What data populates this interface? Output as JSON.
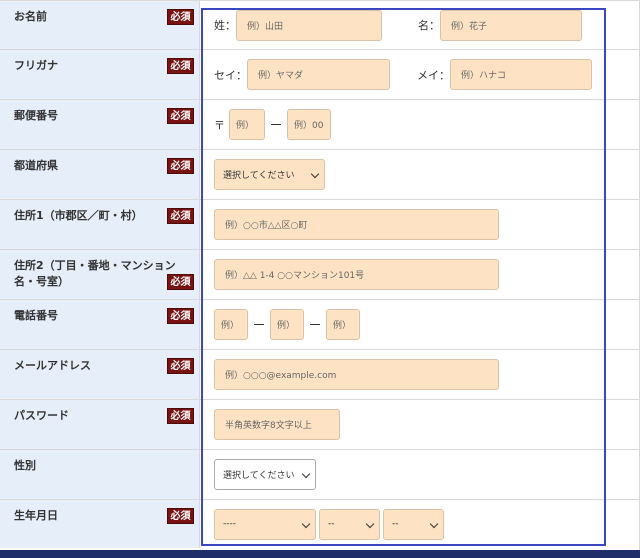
{
  "required_label": "必須",
  "fields": {
    "name": {
      "label": "お名前",
      "sei_label": "姓：",
      "sei_placeholder": "例）山田",
      "mei_label": "名：",
      "mei_placeholder": "例）花子"
    },
    "furigana": {
      "label": "フリガナ",
      "sei_label": "セイ：",
      "sei_placeholder": "例）ヤマダ",
      "mei_label": "メイ：",
      "mei_placeholder": "例）ハナコ"
    },
    "postal": {
      "label": "郵便番号",
      "mark": "〒",
      "first_placeholder": "例）",
      "second_placeholder": "例）00"
    },
    "prefecture": {
      "label": "都道府県",
      "selected": "選択してください"
    },
    "address1": {
      "label": "住所1（市郡区／町・村）",
      "placeholder": "例）○○市△△区○町"
    },
    "address2": {
      "label": "住所2（丁目・番地・マンション名・号室）",
      "placeholder": "例）△△ 1-4 ○○マンション101号"
    },
    "phone": {
      "label": "電話番号",
      "p1": "例）",
      "p2": "例）",
      "p3": "例）"
    },
    "email": {
      "label": "メールアドレス",
      "placeholder": "例）○○○@example.com"
    },
    "password": {
      "label": "パスワード",
      "placeholder": "半角英数字8文字以上"
    },
    "gender": {
      "label": "性別",
      "selected": "選択してください"
    },
    "birthday": {
      "label": "生年月日",
      "year": "----",
      "month": "--",
      "day": "--"
    }
  },
  "colors": {
    "label_bg": "#e6eefa",
    "input_bg": "#fde3c4",
    "badge": "#7a1212",
    "highlight": "#3a47c0",
    "footer": "#1f2e6a"
  }
}
